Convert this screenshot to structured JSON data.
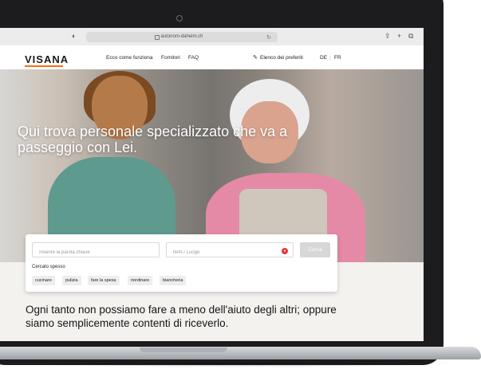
{
  "browser": {
    "url": "autonom-daheim.ch",
    "icons": [
      "sidebar-icon",
      "share-icon",
      "new-tab-icon",
      "tabs-icon"
    ]
  },
  "nav": {
    "logo": "VISANA",
    "links": [
      "Ecco come funziona",
      "Fornitori",
      "FAQ"
    ],
    "favorites": "Elenco dei preferiti",
    "languages": [
      "DE",
      "FR"
    ]
  },
  "hero": {
    "title": "Qui trova personale specializzato che va a passeggio con Lei."
  },
  "search": {
    "keyword_placeholder": "Inserire la parola chiave",
    "location_placeholder": "NPA / Luogo",
    "button": "Cerca",
    "frequent_label": "Cercato spesso",
    "tags": [
      "cucinare",
      "pulizia",
      "fare la spesa",
      "riordinare",
      "biancheria"
    ]
  },
  "intro": {
    "text": "Ogni tanto non possiamo fare a meno dell'aiuto degli altri; oppure siamo semplicemente contenti di riceverlo."
  },
  "colors": {
    "accent": "#ff6a13",
    "location_button": "#e53935",
    "search_button": "#d7d7d7"
  }
}
